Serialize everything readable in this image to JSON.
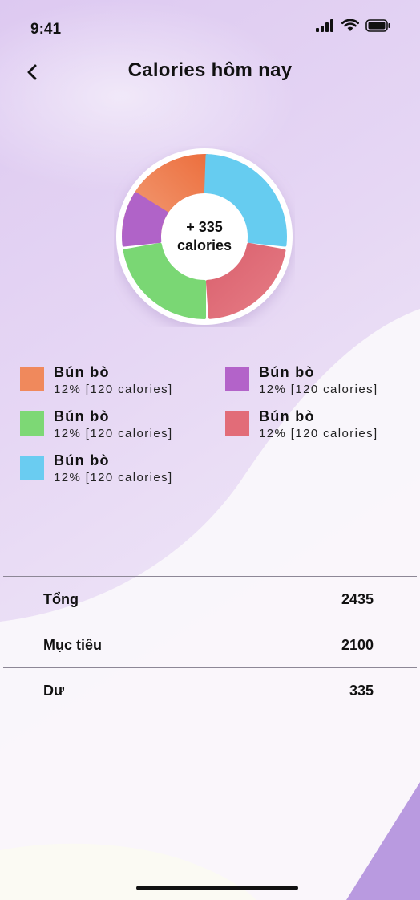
{
  "status_bar": {
    "time": "9:41"
  },
  "header": {
    "title": "Calories hôm nay"
  },
  "donut": {
    "center_line1": "+ 335",
    "center_line2": "calories",
    "segments": [
      {
        "name": "orange",
        "color": "#ee8a5e"
      },
      {
        "name": "blue",
        "color": "#66ccf0"
      },
      {
        "name": "red",
        "color": "#e06e7a"
      },
      {
        "name": "green",
        "color": "#7ad774"
      },
      {
        "name": "purple",
        "color": "#b063c8"
      }
    ]
  },
  "legend": [
    {
      "name": "Bún bò",
      "detail": "12% [120 calories]",
      "color": "#f0895c"
    },
    {
      "name": "Bún bò",
      "detail": "12% [120 calories]",
      "color": "#b363c9"
    },
    {
      "name": "Bún bò",
      "detail": "12% [120 calories]",
      "color": "#7dd875"
    },
    {
      "name": "Bún bò",
      "detail": "12% [120 calories]",
      "color": "#e26c78"
    },
    {
      "name": "Bún bò",
      "detail": "12% [120 calories]",
      "color": "#6accf1"
    }
  ],
  "summary": [
    {
      "label": "Tổng",
      "value": "2435"
    },
    {
      "label": "Mục tiêu",
      "value": "2100"
    },
    {
      "label": "Dư",
      "value": "335"
    }
  ],
  "colors": {
    "accent_purple": "#c7a6e6",
    "background": "#f6f1fa"
  }
}
